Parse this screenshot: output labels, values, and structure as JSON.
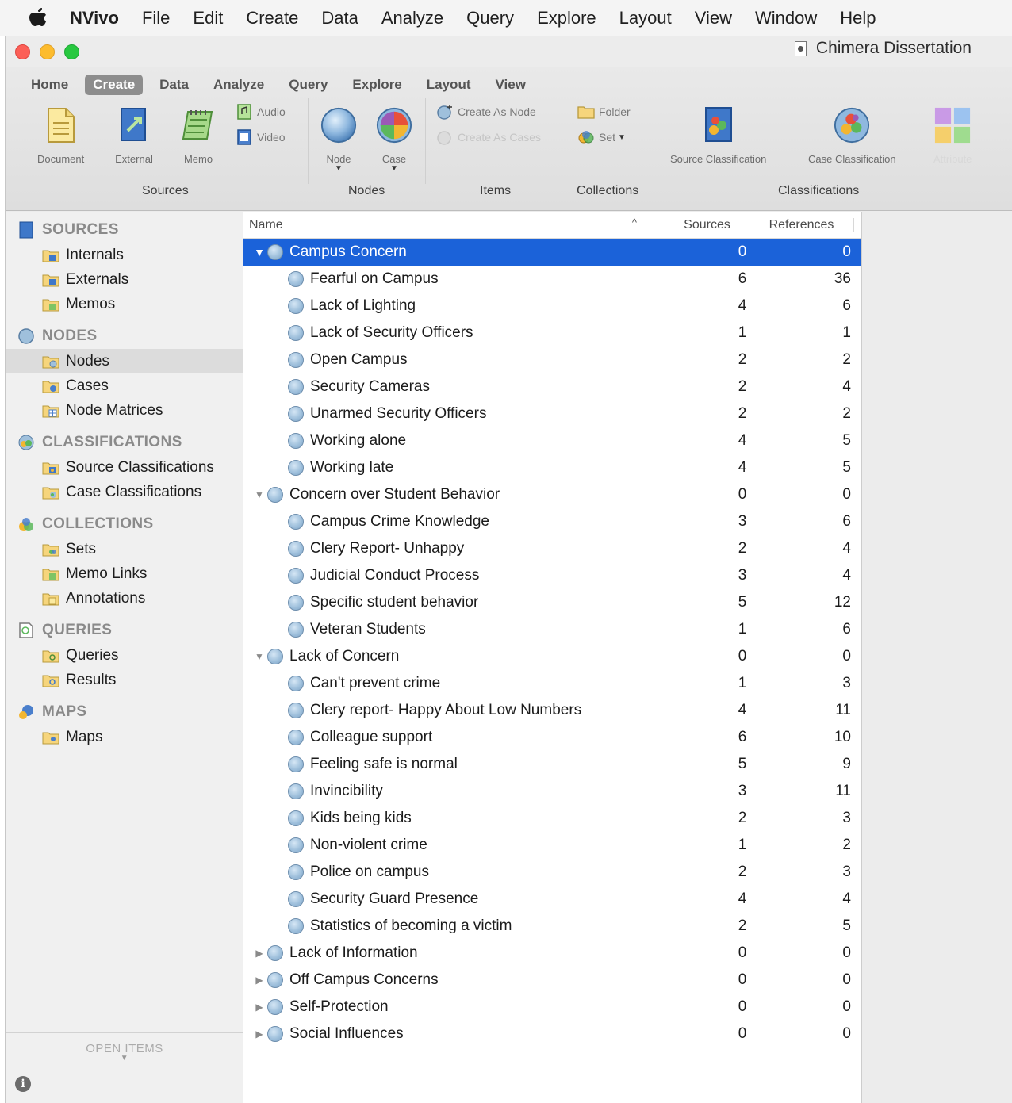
{
  "menubar": {
    "app": "NVivo",
    "items": [
      "File",
      "Edit",
      "Create",
      "Data",
      "Analyze",
      "Query",
      "Explore",
      "Layout",
      "View",
      "Window",
      "Help"
    ]
  },
  "window": {
    "title": "Chimera Dissertation"
  },
  "ribbon": {
    "tabs": [
      "Home",
      "Create",
      "Data",
      "Analyze",
      "Query",
      "Explore",
      "Layout",
      "View"
    ],
    "active_tab": "Create",
    "buttons": {
      "document": "Document",
      "external": "External",
      "memo": "Memo",
      "audio": "Audio",
      "video": "Video",
      "node": "Node",
      "case": "Case",
      "create_as_node": "Create As Node",
      "create_as_cases": "Create As Cases",
      "folder": "Folder",
      "set": "Set",
      "source_classification": "Source Classification",
      "case_classification": "Case Classification",
      "attribute": "Attribute"
    },
    "groups": {
      "sources": "Sources",
      "nodes": "Nodes",
      "items": "Items",
      "collections": "Collections",
      "classifications": "Classifications"
    }
  },
  "sidebar": {
    "sections": [
      {
        "title": "SOURCES",
        "icon": "sources-icon",
        "items": [
          "Internals",
          "Externals",
          "Memos"
        ]
      },
      {
        "title": "NODES",
        "icon": "nodes-icon",
        "items": [
          "Nodes",
          "Cases",
          "Node Matrices"
        ]
      },
      {
        "title": "CLASSIFICATIONS",
        "icon": "classifications-icon",
        "items": [
          "Source Classifications",
          "Case Classifications"
        ]
      },
      {
        "title": "COLLECTIONS",
        "icon": "collections-icon",
        "items": [
          "Sets",
          "Memo Links",
          "Annotations"
        ]
      },
      {
        "title": "QUERIES",
        "icon": "queries-icon",
        "items": [
          "Queries",
          "Results"
        ]
      },
      {
        "title": "MAPS",
        "icon": "maps-icon",
        "items": [
          "Maps"
        ]
      }
    ],
    "selected_item": "Nodes",
    "open_items": "OPEN ITEMS"
  },
  "table": {
    "columns": {
      "name": "Name",
      "sources": "Sources",
      "references": "References"
    },
    "rows": [
      {
        "name": "Campus Concern",
        "sources": "0",
        "references": "0",
        "level": 0,
        "state": "expanded",
        "selected": true
      },
      {
        "name": "Fearful on Campus",
        "sources": "6",
        "references": "36",
        "level": 1
      },
      {
        "name": "Lack of Lighting",
        "sources": "4",
        "references": "6",
        "level": 1
      },
      {
        "name": "Lack of Security Officers",
        "sources": "1",
        "references": "1",
        "level": 1
      },
      {
        "name": "Open Campus",
        "sources": "2",
        "references": "2",
        "level": 1
      },
      {
        "name": "Security Cameras",
        "sources": "2",
        "references": "4",
        "level": 1
      },
      {
        "name": "Unarmed Security Officers",
        "sources": "2",
        "references": "2",
        "level": 1
      },
      {
        "name": "Working alone",
        "sources": "4",
        "references": "5",
        "level": 1
      },
      {
        "name": "Working late",
        "sources": "4",
        "references": "5",
        "level": 1
      },
      {
        "name": "Concern over Student Behavior",
        "sources": "0",
        "references": "0",
        "level": 0,
        "state": "expanded"
      },
      {
        "name": "Campus Crime Knowledge",
        "sources": "3",
        "references": "6",
        "level": 1
      },
      {
        "name": "Clery Report- Unhappy",
        "sources": "2",
        "references": "4",
        "level": 1
      },
      {
        "name": "Judicial Conduct Process",
        "sources": "3",
        "references": "4",
        "level": 1
      },
      {
        "name": "Specific student behavior",
        "sources": "5",
        "references": "12",
        "level": 1
      },
      {
        "name": "Veteran Students",
        "sources": "1",
        "references": "6",
        "level": 1
      },
      {
        "name": "Lack of Concern",
        "sources": "0",
        "references": "0",
        "level": 0,
        "state": "expanded"
      },
      {
        "name": "Can't prevent crime",
        "sources": "1",
        "references": "3",
        "level": 1
      },
      {
        "name": "Clery report- Happy About Low Numbers",
        "sources": "4",
        "references": "11",
        "level": 1
      },
      {
        "name": "Colleague support",
        "sources": "6",
        "references": "10",
        "level": 1
      },
      {
        "name": "Feeling safe is normal",
        "sources": "5",
        "references": "9",
        "level": 1
      },
      {
        "name": "Invincibility",
        "sources": "3",
        "references": "11",
        "level": 1
      },
      {
        "name": "Kids being kids",
        "sources": "2",
        "references": "3",
        "level": 1
      },
      {
        "name": "Non-violent crime",
        "sources": "1",
        "references": "2",
        "level": 1
      },
      {
        "name": "Police on campus",
        "sources": "2",
        "references": "3",
        "level": 1
      },
      {
        "name": "Security Guard Presence",
        "sources": "4",
        "references": "4",
        "level": 1
      },
      {
        "name": "Statistics of becoming a victim",
        "sources": "2",
        "references": "5",
        "level": 1
      },
      {
        "name": "Lack of Information",
        "sources": "0",
        "references": "0",
        "level": 0,
        "state": "collapsed"
      },
      {
        "name": "Off Campus Concerns",
        "sources": "0",
        "references": "0",
        "level": 0,
        "state": "collapsed"
      },
      {
        "name": "Self-Protection",
        "sources": "0",
        "references": "0",
        "level": 0,
        "state": "collapsed"
      },
      {
        "name": "Social Influences",
        "sources": "0",
        "references": "0",
        "level": 0,
        "state": "collapsed"
      }
    ]
  },
  "colors": {
    "selection": "#1b62d9",
    "traffic_red": "#fc5f57",
    "traffic_yellow": "#fdbc2e",
    "traffic_green": "#28c840"
  }
}
